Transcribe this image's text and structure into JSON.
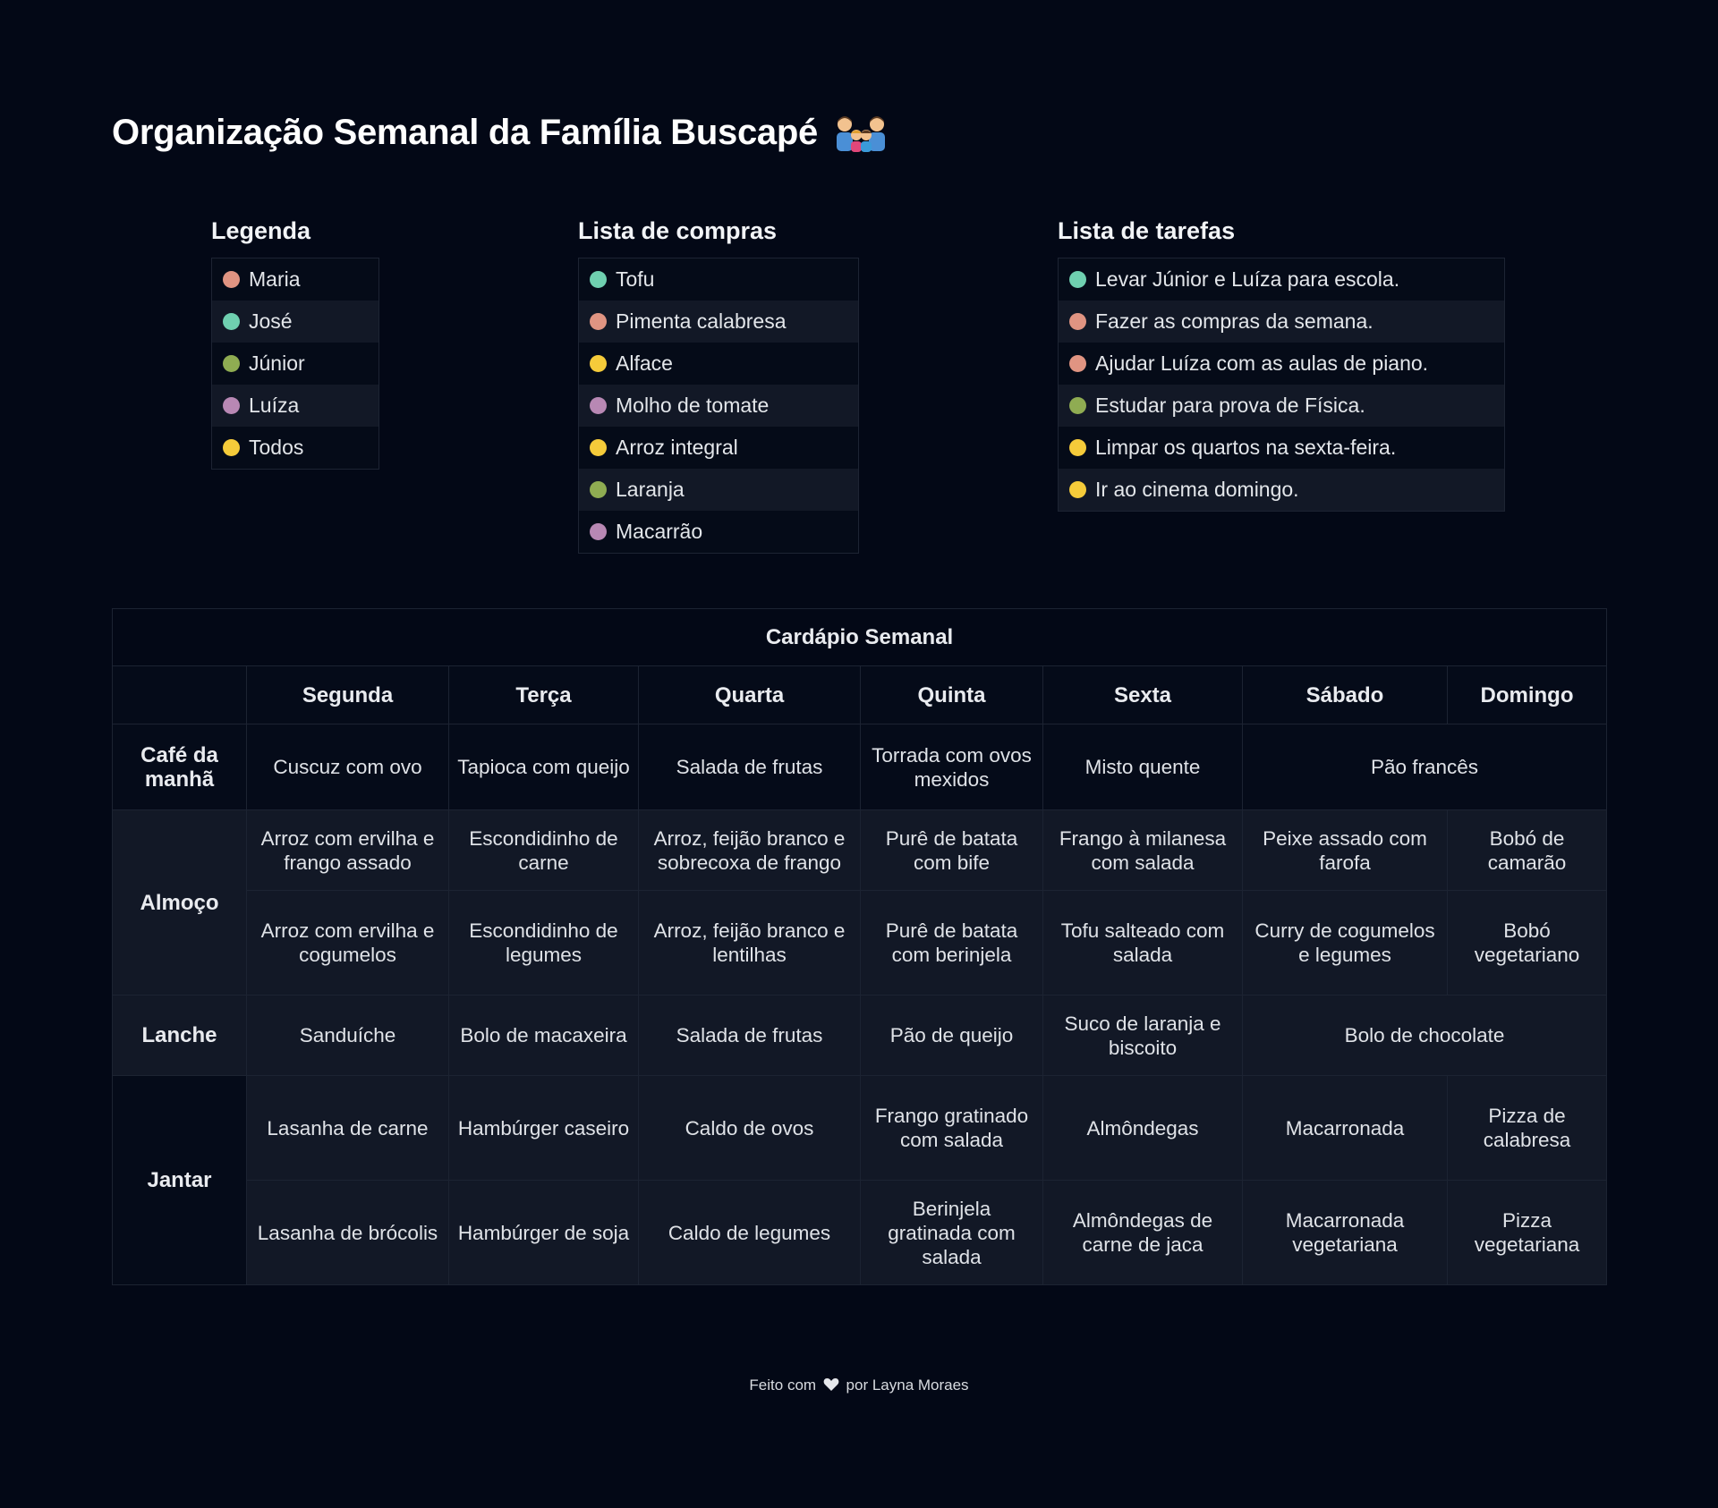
{
  "title": "Organização Semanal da Família Buscapé",
  "title_icon": "family-emoji-icon",
  "colors": {
    "background": "#030816",
    "maria": "#e09482",
    "jose": "#6fd0b0",
    "junior": "#8fac52",
    "luiza": "#b888b4",
    "todos": "#f5cb3a"
  },
  "legend": {
    "heading": "Legenda",
    "items": [
      {
        "label": "Maria",
        "color": "#e09482"
      },
      {
        "label": "José",
        "color": "#6fd0b0"
      },
      {
        "label": "Júnior",
        "color": "#8fac52"
      },
      {
        "label": "Luíza",
        "color": "#b888b4"
      },
      {
        "label": "Todos",
        "color": "#f5cb3a"
      }
    ]
  },
  "shopping": {
    "heading": "Lista de compras",
    "items": [
      {
        "label": "Tofu",
        "color": "#6fd0b0"
      },
      {
        "label": "Pimenta calabresa",
        "color": "#e09482"
      },
      {
        "label": "Alface",
        "color": "#f5cb3a"
      },
      {
        "label": "Molho de tomate",
        "color": "#b888b4"
      },
      {
        "label": "Arroz integral",
        "color": "#f5cb3a"
      },
      {
        "label": "Laranja",
        "color": "#8fac52"
      },
      {
        "label": "Macarrão",
        "color": "#b888b4"
      }
    ]
  },
  "tasks": {
    "heading": "Lista de tarefas",
    "items": [
      {
        "label": "Levar Júnior e Luíza para escola.",
        "color": "#6fd0b0"
      },
      {
        "label": "Fazer as compras da semana.",
        "color": "#e09482"
      },
      {
        "label": "Ajudar Luíza com as aulas de piano.",
        "color": "#e09482"
      },
      {
        "label": "Estudar para prova de Física.",
        "color": "#8fac52"
      },
      {
        "label": "Limpar os quartos na sexta-feira.",
        "color": "#f5cb3a"
      },
      {
        "label": "Ir ao cinema domingo.",
        "color": "#f5cb3a"
      }
    ]
  },
  "menu": {
    "caption": "Cardápio Semanal",
    "days": [
      "Segunda",
      "Terça",
      "Quarta",
      "Quinta",
      "Sexta",
      "Sábado",
      "Domingo"
    ],
    "meals": {
      "breakfast": "Café da manhã",
      "lunch": "Almoço",
      "snack": "Lanche",
      "dinner": "Jantar"
    },
    "breakfast": [
      "Cuscuz com ovo",
      "Tapioca com queijo",
      "Salada de frutas",
      "Torrada com ovos mexidos",
      "Misto quente",
      "Pão francês"
    ],
    "lunch_1": [
      "Arroz com ervilha e frango assado",
      "Escondidinho de carne",
      "Arroz, feijão branco e sobrecoxa de frango",
      "Purê de batata com bife",
      "Frango à milanesa com salada",
      "Peixe assado com farofa",
      "Bobó de camarão"
    ],
    "lunch_2": [
      "Arroz com ervilha e cogumelos",
      "Escondidinho de legumes",
      "Arroz, feijão branco e lentilhas",
      "Purê de batata com berinjela",
      "Tofu salteado com salada",
      "Curry de cogumelos e legumes",
      "Bobó vegetariano"
    ],
    "snack": [
      "Sanduíche",
      "Bolo de macaxeira",
      "Salada de frutas",
      "Pão de queijo",
      "Suco de laranja e biscoito",
      "Bolo de chocolate"
    ],
    "dinner_1": [
      "Lasanha de carne",
      "Hambúrger caseiro",
      "Caldo de ovos",
      "Frango gratinado com salada",
      "Almôndegas",
      "Macarronada",
      "Pizza de calabresa"
    ],
    "dinner_2": [
      "Lasanha de brócolis",
      "Hambúrger de soja",
      "Caldo de legumes",
      "Berinjela gratinada com salada",
      "Almôndegas de carne de jaca",
      "Macarronada vegetariana",
      "Pizza vegetariana"
    ]
  },
  "footer": {
    "prefix": "Feito com",
    "icon": "heart-icon",
    "suffix": "por Layna Moraes"
  }
}
